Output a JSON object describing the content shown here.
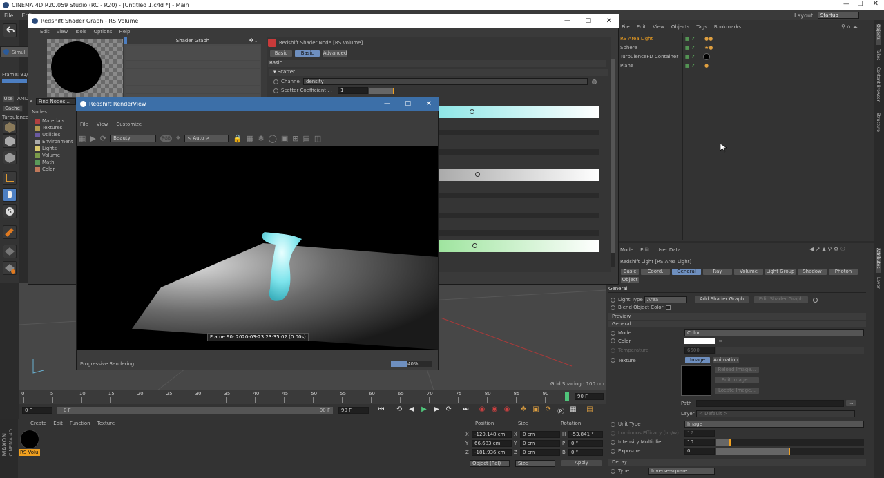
{
  "colors": {
    "accent": "#4d7fc2",
    "orange": "#f0a020",
    "selected": "#cc8f3a"
  },
  "app": {
    "title": "CINEMA 4D R20.059 Studio (RC - R20) - [Untitled 1.c4d *] - Main",
    "menu": [
      "File",
      "Edit"
    ],
    "layout_label": "Layout:",
    "layout_value": "Startup"
  },
  "om": {
    "menu": [
      "File",
      "Edit",
      "View",
      "Objects",
      "Tags",
      "Bookmarks"
    ],
    "objects": [
      {
        "name": "RS Area Light",
        "selected": true
      },
      {
        "name": "Sphere",
        "selected": false
      },
      {
        "name": "TurbulenceFD Container",
        "selected": false
      },
      {
        "name": "Plane",
        "selected": false
      }
    ]
  },
  "right_tabs": [
    "Objects",
    "Takes",
    "Content Browser",
    "Structure"
  ],
  "right_tabs2": [
    "Attributes",
    "Layer"
  ],
  "left": {
    "sim_tab": "Simul",
    "frame": "Frame: 91/",
    "use": "Use",
    "amd": "AMD",
    "cache": "Cache",
    "turb": "Turbulence"
  },
  "sg": {
    "title": "Redshift Shader Graph - RS Volume",
    "menu": [
      "Edit",
      "View",
      "Tools",
      "Options",
      "Help"
    ],
    "panel_title": "Shader Graph",
    "find": "Find Nodes...",
    "nodes_header": "Nodes",
    "nodes": [
      {
        "name": "Materials",
        "color": "#b04040"
      },
      {
        "name": "Textures",
        "color": "#b09a50"
      },
      {
        "name": "Utilities",
        "color": "#6a5aa0"
      },
      {
        "name": "Environment",
        "color": "#aaaaaa"
      },
      {
        "name": "Lights",
        "color": "#d8c870"
      },
      {
        "name": "Volume",
        "color": "#7a9a4a"
      },
      {
        "name": "Math",
        "color": "#5a9a5a"
      },
      {
        "name": "Color",
        "color": "#c0785a"
      }
    ],
    "node_title": "Redshift Shader Node [RS Volume]",
    "tabs": [
      "Basic",
      "Basic",
      "Advanced"
    ],
    "section": "Basic",
    "scatter": "Scatter",
    "channel_label": "Channel",
    "channel_value": "density",
    "coef_label": "Scatter Coefficient . .",
    "coef_value": "1"
  },
  "rv": {
    "title": "Redshift RenderView",
    "menu": [
      "File",
      "View",
      "Customize"
    ],
    "aov": "Beauty",
    "rgb": "RGB",
    "zoom": "< Auto >",
    "frame_text": "Frame  90:  2020-03-23  23:35:02  (0.00s)",
    "status": "Progressive Rendering...",
    "progress": 0.4,
    "progress_text": "40%"
  },
  "viewport": {
    "grid": "Grid Spacing : 100 cm"
  },
  "timeline": {
    "ticks": [
      "0",
      "5",
      "10",
      "15",
      "20",
      "25",
      "30",
      "35",
      "40",
      "45",
      "50",
      "55",
      "60",
      "65",
      "70",
      "75",
      "80",
      "85",
      "90"
    ],
    "current_frame": "90 F",
    "start": "0 F",
    "range_start": "0 F",
    "range_end": "90 F",
    "end": "90 F"
  },
  "mat": {
    "menu": [
      "Create",
      "Edit",
      "Function",
      "Texture"
    ],
    "name": "RS Volu",
    "brand_top": "MAXON",
    "brand_bottom": "CINEMA 4D"
  },
  "coords": {
    "headers": [
      "Position",
      "Size",
      "Rotation"
    ],
    "rows": [
      {
        "axis": "X",
        "pos": "-120.148 cm",
        "size": "0 cm",
        "rlabel": "H",
        "rot": "-53.841 °"
      },
      {
        "axis": "Y",
        "pos": "66.683 cm",
        "size": "0 cm",
        "rlabel": "P",
        "rot": "0 °"
      },
      {
        "axis": "Z",
        "pos": "-181.936 cm",
        "size": "0 cm",
        "rlabel": "B",
        "rot": "0 °"
      }
    ],
    "mode1": "Object (Rel)",
    "mode2": "Size",
    "apply": "Apply"
  },
  "am": {
    "menu": [
      "Mode",
      "Edit",
      "User Data"
    ],
    "title": "Redshift Light [RS Area Light]",
    "tabs": [
      "Basic",
      "Coord.",
      "General",
      "Ray",
      "Volume",
      "Light Group",
      "Shadow",
      "Photon"
    ],
    "tab2": "Object",
    "section_general": "General",
    "light_type_label": "Light Type",
    "light_type": "Area",
    "add_sg": "Add Shader Graph",
    "edit_sg": "Edit Shader Graph",
    "blend": "Blend Object Color",
    "preview": "Preview",
    "general": "General",
    "mode_label": "Mode",
    "mode": "Color",
    "color_label": "Color",
    "temp_label": "Temperature",
    "temp": "6500",
    "texture_label": "Texture",
    "image_tab": "Image",
    "anim_tab": "Animation",
    "reload": "Reload Image...",
    "edit_img": "Edit Image...",
    "locate": "Locate Image...",
    "path_label": "Path",
    "layer_label": "Layer",
    "layer_value": "< Default >",
    "unit_label": "Unit Type",
    "unit": "Image",
    "lum_label": "Luminous Efficacy (lm/w)",
    "lum": "17",
    "int_label": "Intensity Multiplier",
    "int": "10",
    "intensity_fill": 0.1,
    "exp_label": "Exposure",
    "exp": "0",
    "exposure_fill": 0.5,
    "decay": "Decay",
    "type_label": "Type",
    "type": "Inverse-square"
  }
}
